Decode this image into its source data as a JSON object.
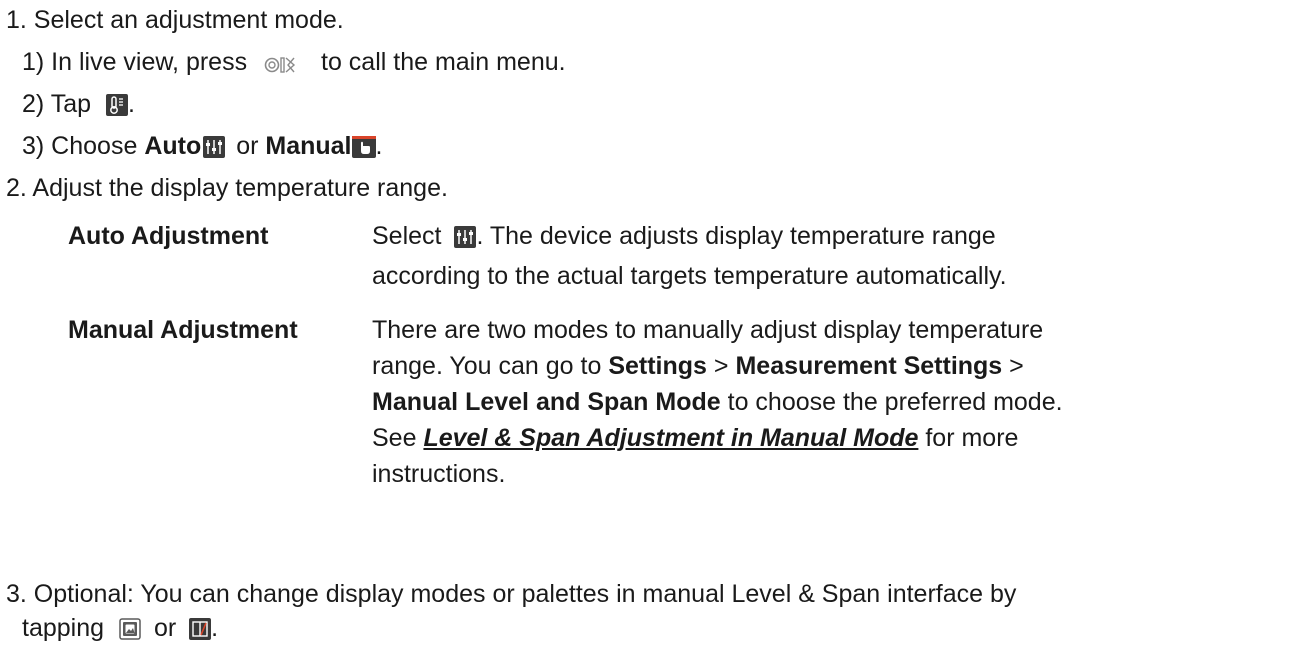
{
  "step1": {
    "title": "1. Select an adjustment mode.",
    "sub1_pre": "1) In live view, press",
    "sub1_post": "to call the main menu.",
    "sub2_pre": "2) Tap",
    "sub2_post": ".",
    "sub3_pre": "3) Choose",
    "auto": "Auto",
    "or": "or",
    "manual": "Manual",
    "sub3_post": "."
  },
  "step2": {
    "title": "2. Adjust the display temperature range."
  },
  "table": {
    "row1": {
      "term": "Auto Adjustment",
      "pre": "Select",
      "line1_post": ". The device adjusts display temperature range",
      "line2": "according to the actual targets temperature automatically."
    },
    "row2": {
      "term": "Manual Adjustment",
      "line1": "There are two modes to manually adjust display temperature",
      "line2_pre": "range. You can go to",
      "settings": "Settings",
      "gt1": ">",
      "measurement_settings": "Measurement Settings",
      "gt2": ">",
      "manual_level_span_mode": "Manual Level and Span Mode",
      "line3_post": "to choose the preferred mode.",
      "see": "See",
      "link": "Level & Span Adjustment in Manual Mode",
      "line4_post": "for more",
      "line5": "instructions."
    }
  },
  "step3": {
    "line1": "3. Optional: You can change display modes or palettes in manual Level & Span interface by",
    "line2_pre": "tapping",
    "or": "or",
    "line2_post": "."
  },
  "colors": {
    "text": "#1a1a1a",
    "icon_dark": "#3a3a3a",
    "icon_accent": "#d9442a"
  },
  "icons": [
    "ok-button-icon",
    "thermometer-icon",
    "auto-adjust-icon",
    "manual-hand-icon",
    "display-mode-icon",
    "palette-icon"
  ]
}
